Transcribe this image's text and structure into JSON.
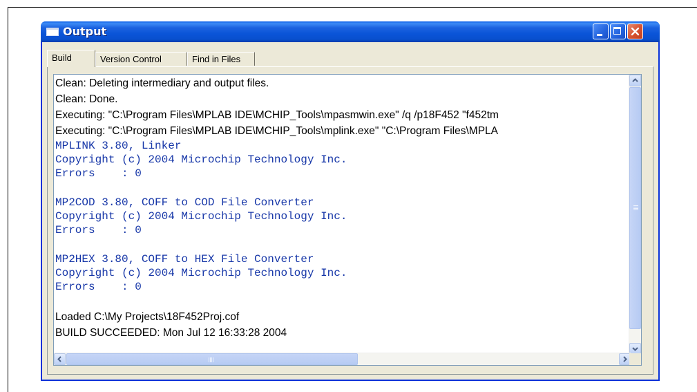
{
  "window": {
    "title": "Output"
  },
  "tabs": [
    {
      "label": "Build",
      "active": true
    },
    {
      "label": "Version Control",
      "active": false
    },
    {
      "label": "Find in Files",
      "active": false
    }
  ],
  "output": {
    "lines": [
      "Clean: Deleting intermediary and output files.",
      "Clean: Done.",
      "Executing: \"C:\\Program Files\\MPLAB IDE\\MCHIP_Tools\\mpasmwin.exe\" /q /p18F452 \"f452tm",
      "Executing: \"C:\\Program Files\\MPLAB IDE\\MCHIP_Tools\\mplink.exe\" \"C:\\Program Files\\MPLA",
      "MPLINK 3.80, Linker",
      "Copyright (c) 2004 Microchip Technology Inc.",
      "Errors    : 0",
      "MP2COD 3.80, COFF to COD File Converter",
      "Copyright (c) 2004 Microchip Technology Inc.",
      "Errors    : 0",
      "MP2HEX 3.80, COFF to HEX File Converter",
      "Copyright (c) 2004 Microchip Technology Inc.",
      "Errors    : 0",
      "Loaded C:\\My Projects\\18F452Proj.cof",
      "BUILD SUCCEEDED: Mon Jul 12 16:33:28 2004"
    ]
  },
  "colors": {
    "title_bar": "#0a54d8",
    "tool_output_text": "#1737a8",
    "status_text": "#000000"
  }
}
